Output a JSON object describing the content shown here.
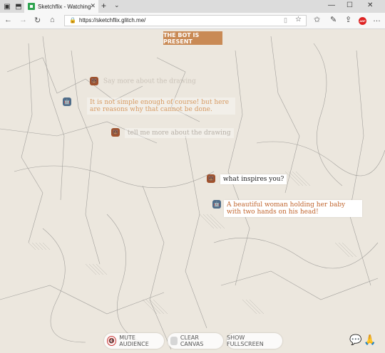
{
  "browser": {
    "tab_title": "Sketchflix - Watching ai",
    "url": "https://sketchflix.glitch.me/"
  },
  "canvas": {
    "banner": "THE BOT IS PRESENT"
  },
  "chat": [
    {
      "speaker": "bear",
      "text": "Say more about the drawing"
    },
    {
      "speaker": "bot",
      "text": "It is not simple enough of course! but here are reasons why that cannot be done."
    },
    {
      "speaker": "bear",
      "text": "tell me more about the drawing"
    },
    {
      "speaker": "bear",
      "text": "what inspires you?"
    },
    {
      "speaker": "bot",
      "text": "A beautiful woman holding her baby with two hands on his head!"
    }
  ],
  "controls": {
    "mute": "MUTE AUDIENCE",
    "clear": "CLEAR CANVAS",
    "fullscreen": "SHOW FULLSCREEN"
  },
  "icons": {
    "bear_face": "🐻",
    "bot_face": "🤖",
    "chat": "💬",
    "pray": "🙏"
  },
  "colors": {
    "banner": "#c98a55",
    "canvas_bg": "#ece7de",
    "bot_text": "#c0652e"
  }
}
